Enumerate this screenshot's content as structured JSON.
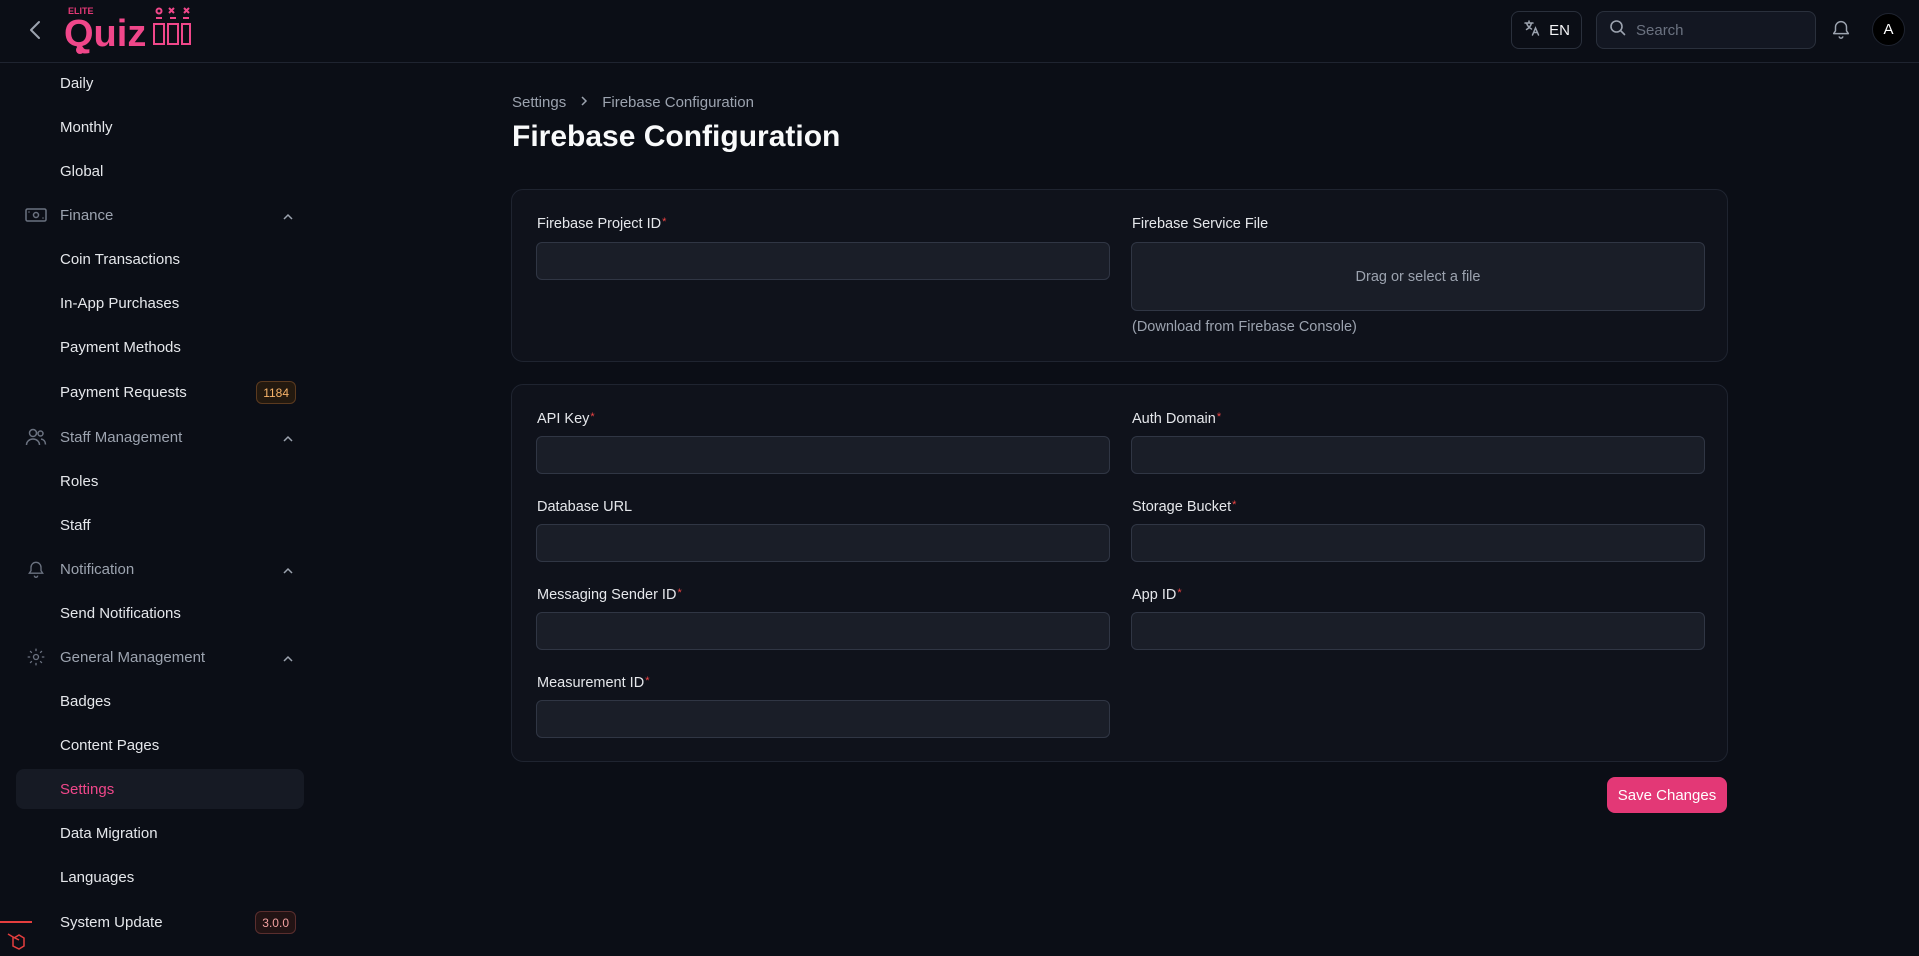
{
  "header": {
    "logo_small": "ELITE",
    "logo_main": "Quiz",
    "language": "EN",
    "search_placeholder": "Search",
    "avatar_initial": "A"
  },
  "sidebar": {
    "items": [
      {
        "label": "Daily",
        "type": "item"
      },
      {
        "label": "Monthly",
        "type": "item"
      },
      {
        "label": "Global",
        "type": "item"
      },
      {
        "label": "Finance",
        "type": "group",
        "icon": "money-icon"
      },
      {
        "label": "Coin Transactions",
        "type": "item"
      },
      {
        "label": "In-App Purchases",
        "type": "item"
      },
      {
        "label": "Payment Methods",
        "type": "item"
      },
      {
        "label": "Payment Requests",
        "type": "item",
        "badge": "1184"
      },
      {
        "label": "Staff Management",
        "type": "group",
        "icon": "users-icon"
      },
      {
        "label": "Roles",
        "type": "item"
      },
      {
        "label": "Staff",
        "type": "item"
      },
      {
        "label": "Notification",
        "type": "group",
        "icon": "bell-icon"
      },
      {
        "label": "Send Notifications",
        "type": "item"
      },
      {
        "label": "General Management",
        "type": "group",
        "icon": "gear-icon"
      },
      {
        "label": "Badges",
        "type": "item"
      },
      {
        "label": "Content Pages",
        "type": "item"
      },
      {
        "label": "Settings",
        "type": "item",
        "active": true
      },
      {
        "label": "Data Migration",
        "type": "item"
      },
      {
        "label": "Languages",
        "type": "item"
      },
      {
        "label": "System Update",
        "type": "item",
        "badge": "3.0.0"
      }
    ]
  },
  "breadcrumb": {
    "parent": "Settings",
    "current": "Firebase Configuration"
  },
  "page": {
    "title": "Firebase Configuration"
  },
  "card1": {
    "project_id_label": "Firebase Project ID",
    "project_id_value": "",
    "service_file_label": "Firebase Service File",
    "service_file_dropzone": "Drag or select a file",
    "service_file_helper": "(Download from Firebase Console)"
  },
  "card2": {
    "api_key_label": "API Key",
    "auth_domain_label": "Auth Domain",
    "database_url_label": "Database URL",
    "storage_bucket_label": "Storage Bucket",
    "messaging_sender_id_label": "Messaging Sender ID",
    "app_id_label": "App ID",
    "measurement_id_label": "Measurement ID",
    "required_mark": "*"
  },
  "actions": {
    "save_label": "Save Changes"
  },
  "colors": {
    "accent": "#e33876",
    "background": "#0b0e16",
    "card": "#0f121b"
  }
}
